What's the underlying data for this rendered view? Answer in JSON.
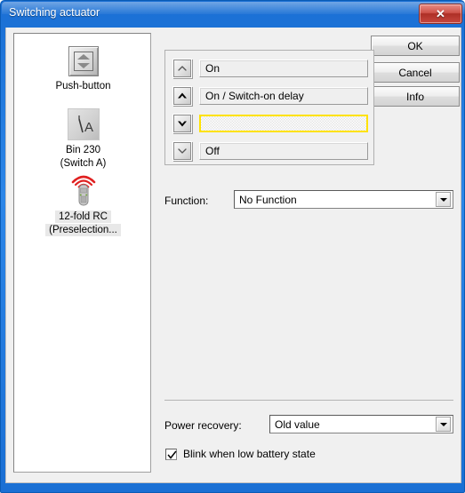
{
  "window": {
    "title": "Switching actuator",
    "close_icon": "close-x-icon"
  },
  "devices": {
    "items": [
      {
        "icon": "push-button-icon",
        "label_lines": [
          "Push-button"
        ],
        "selected": false
      },
      {
        "icon": "switch-icon",
        "label_lines": [
          "Bin 230",
          "(Switch A)"
        ],
        "selected": false
      },
      {
        "icon": "remote-control-icon",
        "label_lines": [
          "12-fold RC",
          "(Preselection..."
        ],
        "selected": true
      }
    ]
  },
  "buttons": {
    "ok": "OK",
    "cancel": "Cancel",
    "info": "Info"
  },
  "state_list": {
    "rows": [
      {
        "arrow": "chevron-up-thin-icon",
        "value": "On",
        "highlighted": false
      },
      {
        "arrow": "chevron-up-bold-icon",
        "value": "On / Switch-on delay",
        "highlighted": false
      },
      {
        "arrow": "chevron-down-bold-icon",
        "value": "",
        "highlighted": true
      },
      {
        "arrow": "chevron-down-thin-icon",
        "value": "Off",
        "highlighted": false
      }
    ]
  },
  "function_field": {
    "label": "Function:",
    "value": "No Function",
    "arrow_icon": "chevron-down-icon"
  },
  "power_recovery": {
    "label": "Power recovery:",
    "value": "Old value",
    "arrow_icon": "chevron-down-icon"
  },
  "blink_option": {
    "label": "Blink when low battery state",
    "checked": true,
    "check_icon": "checkmark-icon"
  },
  "colors": {
    "titlebar": "#2c86e8",
    "highlight_border": "#ffe200",
    "dialog_bg": "#f0f0f0",
    "close_button": "#ad2f26"
  }
}
